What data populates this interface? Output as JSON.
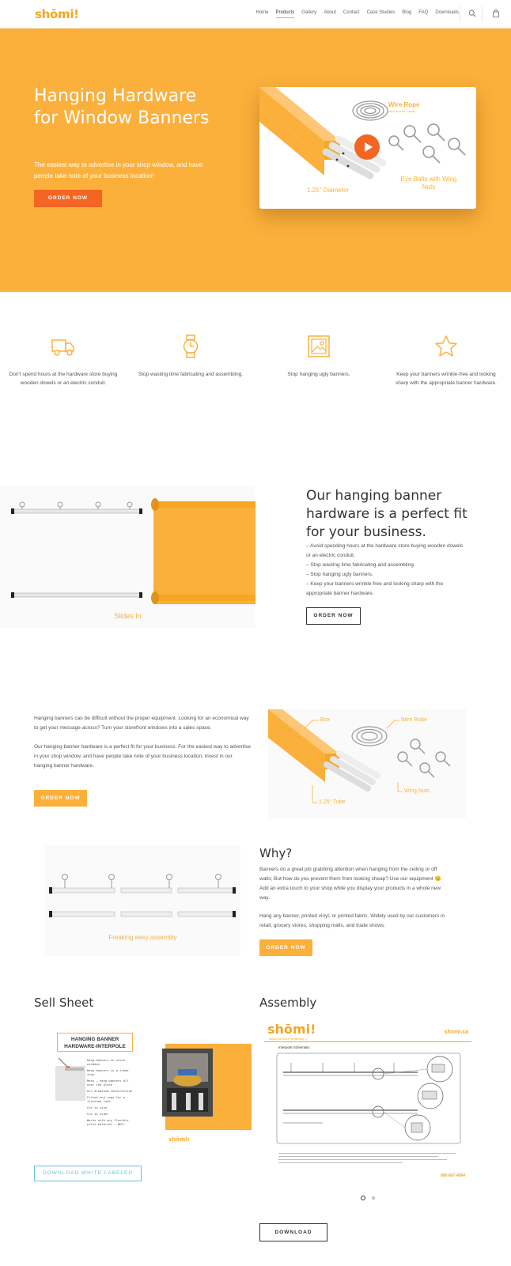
{
  "header": {
    "logo": "shōmi!",
    "nav": [
      "Home",
      "Products",
      "Gallery",
      "About",
      "Contact",
      "Case Studies",
      "Blog",
      "FAQ",
      "Downloads"
    ],
    "active_nav": "Products"
  },
  "hero": {
    "title": "Hanging Hardware for Window Banners",
    "subtitle": "The easiest way to advertise in your shop window, and have people take note of your business location!",
    "cta": "ORDER NOW",
    "video": {
      "label_rope": "Wire Rope",
      "label_rope_sub": "(aka Aircraft Cable)",
      "label_bolts": "Eye Bolts with Wing Nuts",
      "label_diameter": "1.25\" Diameter"
    }
  },
  "features": [
    {
      "icon": "truck-icon",
      "text": "Don't spend hours at the hardware store buying wooden dowels or an electric conduit."
    },
    {
      "icon": "watch-icon",
      "text": "Stop wasting time fabricating and assembling."
    },
    {
      "icon": "picture-icon",
      "text": "Stop hanging ugly banners."
    },
    {
      "icon": "star-icon",
      "text": "Keep your banners wrinkle-free and looking sharp with the appropriate banner hardware."
    }
  ],
  "fit_section": {
    "image_caption": "Slides In",
    "title": "Our hanging banner hardware is a perfect fit for your business.",
    "bullets": [
      "– Avoid spending hours at the hardware store buying wooden dowels or an electric conduit.",
      "– Stop wasting time fabricating and assembling.",
      "– Stop hanging ugly banners.",
      "– Keep your banners wrinkle-free and looking sharp with the appropriate banner hardware."
    ],
    "cta": "ORDER NOW"
  },
  "intro_section": {
    "p1": "Hanging banners can be difficult without the proper equipment. Looking for an economical way to get your message across? Turn your storefront windows into a sales space.",
    "p2": "Our hanging banner hardware is a perfect fit for your business. For the easiest way to advertise in your shop window, and have people take note of your business location, invest in our hanging banner hardware.",
    "cta": "ORDER NOW",
    "diagram": {
      "box": "Box",
      "rope": "Wire Robe",
      "tube": "1.25\" Tube",
      "nuts": "Wing Nuts"
    }
  },
  "why_section": {
    "image_caption": "Freaking easy assembly",
    "title": "Why?",
    "p1": "Banners do a great job grabbing attention when hanging from the ceiling or off walls; But how do you prevent them from looking cheap? Use our equipment 😊 Add an extra touch to your shop while you display your products in a whole new way.",
    "p2": "Hang any banner, printed vinyl, or printed fabric. Widely used by our customers in retail, grocery stores, shopping malls, and trade shows.",
    "cta": "ORDER NOW"
  },
  "sell_sheet": {
    "title": "Sell Sheet",
    "doc_heading": "HANGING BANNER HARDWARE-INTERPOLE",
    "doc_points": [
      "Hang banners in store windows",
      "Hang banners in a trade show",
      "Mesh – hang banners all over the place",
      "All aluminum construction",
      "Fitted end caps for a finished look",
      "Cut to size",
      "Cut to order",
      "Works with any flexible print material – WHY!"
    ],
    "doc_logo": "shōmi!",
    "download": "DOWNLOAD WHITE LABELED"
  },
  "assembly": {
    "title": "Assembly",
    "doc_logo": "shōmi!",
    "doc_tagline": "solutions since yesterday :)",
    "doc_site": "shomi.ca",
    "doc_section": "Interpole Schematic",
    "doc_phone": "866-667-4664",
    "download": "DOWNLOAD"
  },
  "colors": {
    "brand": "#fbb03b",
    "cta": "#f26522",
    "text": "#555555",
    "heading": "#333333"
  }
}
